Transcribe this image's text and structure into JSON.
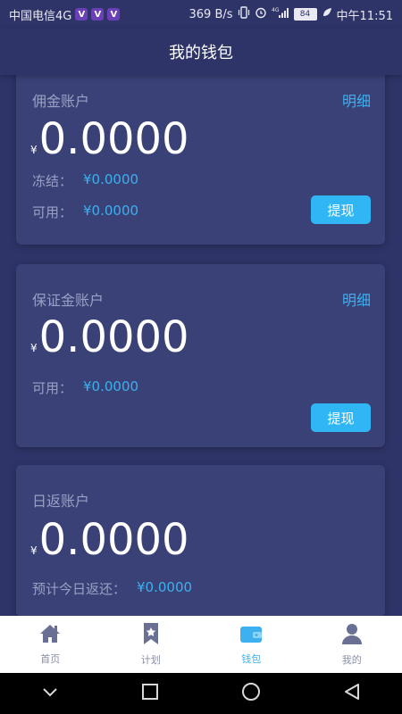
{
  "status_bar": {
    "carrier": "中国电信4G",
    "net_speed": "369 B/s",
    "signal_label": "4G",
    "battery": "84",
    "time": "中午11:51"
  },
  "header": {
    "title": "我的钱包"
  },
  "cards": [
    {
      "title": "佣金账户",
      "link": "明细",
      "currency": "¥",
      "amount": "0.0000",
      "rows": [
        {
          "label": "冻结：",
          "value": "¥0.0000"
        },
        {
          "label": "可用：",
          "value": "¥0.0000"
        }
      ],
      "button": "提现"
    },
    {
      "title": "保证金账户",
      "link": "明细",
      "currency": "¥",
      "amount": "0.0000",
      "rows": [
        {
          "label": "可用：",
          "value": "¥0.0000"
        }
      ],
      "button": "提现"
    },
    {
      "title": "日返账户",
      "currency": "¥",
      "amount": "0.0000",
      "rows": [
        {
          "label": "预计今日返还：",
          "value": "¥0.0000"
        }
      ]
    }
  ],
  "tabs": [
    {
      "label": "首页",
      "icon": "home-icon",
      "active": false
    },
    {
      "label": "计划",
      "icon": "bookmark-star-icon",
      "active": false
    },
    {
      "label": "钱包",
      "icon": "wallet-icon",
      "active": true
    },
    {
      "label": "我的",
      "icon": "person-icon",
      "active": false
    }
  ],
  "colors": {
    "background": "#2e3468",
    "card": "#3a4176",
    "accent": "#3db0ef",
    "button": "#30b6f4",
    "muted_text": "#9aa0c4",
    "tab_active": "#3db0ef",
    "tab_inactive": "#6a7094"
  }
}
